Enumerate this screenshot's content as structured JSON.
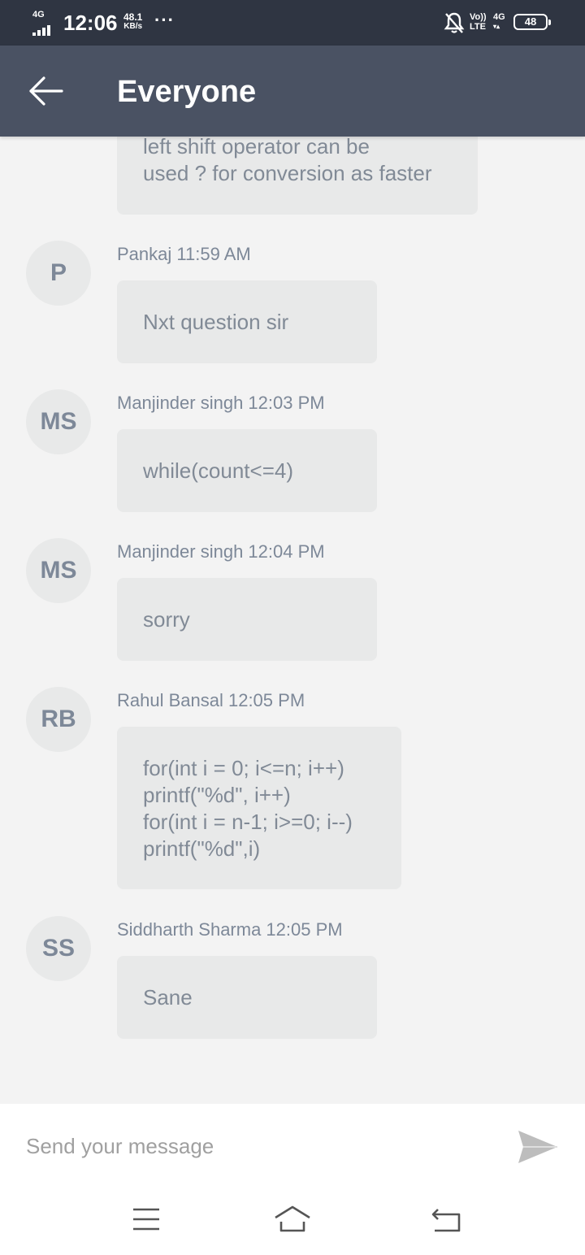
{
  "status_bar": {
    "network": "4G",
    "time": "12:06",
    "speed_value": "48.1",
    "speed_unit": "KB/s",
    "more": "···",
    "volte_top": "Vo))",
    "volte_bottom": "LTE",
    "data_type": "4G",
    "battery": "48"
  },
  "header": {
    "title": "Everyone",
    "back_icon": "arrow-left-icon"
  },
  "messages": [
    {
      "text": "left shift operator can be\nused ? for conversion as faster"
    },
    {
      "initials": "P",
      "sender": "Pankaj",
      "time": "11:59 AM",
      "meta": "Pankaj 11:59 AM",
      "text": "Nxt question sir"
    },
    {
      "initials": "MS",
      "sender": "Manjinder singh",
      "time": "12:03 PM",
      "meta": "Manjinder singh 12:03 PM",
      "text": "while(count<=4)"
    },
    {
      "initials": "MS",
      "sender": "Manjinder singh",
      "time": "12:04 PM",
      "meta": "Manjinder singh 12:04 PM",
      "text": "sorry"
    },
    {
      "initials": "RB",
      "sender": "Rahul Bansal",
      "time": "12:05 PM",
      "meta": "Rahul Bansal 12:05 PM",
      "text": "for(int i = 0; i<=n; i++)\nprintf(\"%d\", i++)\nfor(int i = n-1; i>=0; i--)\nprintf(\"%d\",i)"
    },
    {
      "initials": "SS",
      "sender": "Siddharth Sharma",
      "time": "12:05 PM",
      "meta": "Siddharth Sharma 12:05 PM",
      "text": "Sane"
    }
  ],
  "composer": {
    "placeholder": "Send your message",
    "send_icon": "send-icon"
  },
  "nav": {
    "menu_icon": "menu-icon",
    "home_icon": "home-icon",
    "back_icon": "back-icon"
  },
  "colors": {
    "status_bar": "#2f3542",
    "app_bar": "#4a5263",
    "background": "#f3f3f3",
    "bubble": "#e8e9e9",
    "text_muted": "#818a96"
  }
}
